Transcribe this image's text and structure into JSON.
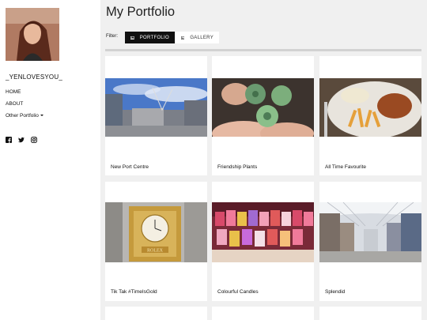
{
  "profile": {
    "username": "_YENLOVESYOU_"
  },
  "nav": {
    "home": "HOME",
    "about": "ABOUT",
    "other": "Other Portfolio"
  },
  "social": [
    "facebook-icon",
    "twitter-icon",
    "instagram-icon"
  ],
  "page": {
    "title": "My Portfolio"
  },
  "filter": {
    "label": "Filter:",
    "portfolio": "PORTFOLIO",
    "gallery": "GALLERY",
    "active": "PORTFOLIO"
  },
  "cards": [
    {
      "caption": "New Port Centre"
    },
    {
      "caption": "Friendship Plants"
    },
    {
      "caption": "All Time Favourite"
    },
    {
      "caption": "Tik Tak #TimeIsGold"
    },
    {
      "caption": "Colourful Candles"
    },
    {
      "caption": "Splendid"
    }
  ],
  "colors": {
    "accent": "#111111",
    "background": "#f0f0f0",
    "card": "#ffffff"
  }
}
